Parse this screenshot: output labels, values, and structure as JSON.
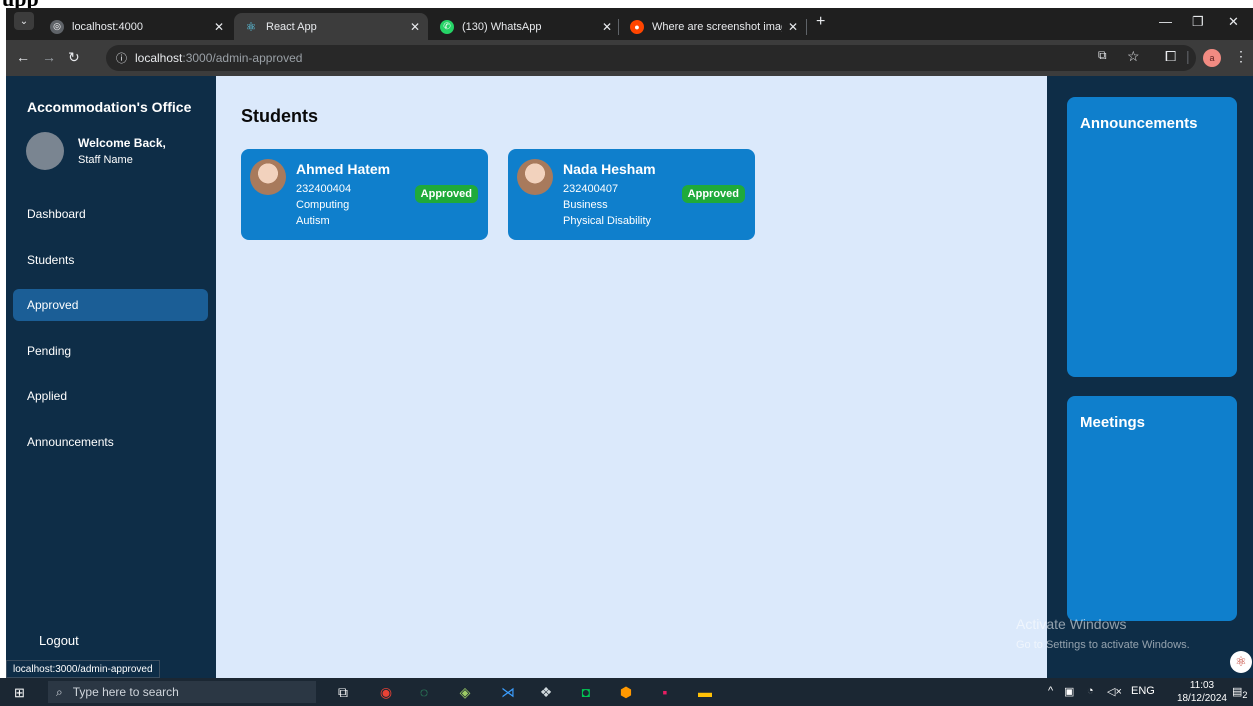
{
  "browser": {
    "tabs": [
      {
        "title": "localhost:4000",
        "active": false
      },
      {
        "title": "React App",
        "active": true
      },
      {
        "title": "(130) WhatsApp",
        "active": false
      },
      {
        "title": "Where are screenshot images s",
        "active": false
      }
    ],
    "new_tab": "+",
    "url_host": "localhost",
    "url_path": ":3000/admin-approved",
    "status_url": "localhost:3000/admin-approved"
  },
  "sidebar": {
    "title": "Accommodation's Office",
    "welcome": "Welcome Back,",
    "staff_name": "Staff Name",
    "items": [
      {
        "label": "Dashboard",
        "active": false
      },
      {
        "label": "Students",
        "active": false
      },
      {
        "label": "Approved",
        "active": true
      },
      {
        "label": "Pending",
        "active": false
      },
      {
        "label": "Applied",
        "active": false
      },
      {
        "label": "Announcements",
        "active": false
      }
    ],
    "logout": "Logout"
  },
  "main": {
    "title": "Students",
    "students": [
      {
        "name": "Ahmed Hatem",
        "id": "232400404",
        "faculty": "Computing",
        "disability": "Autism",
        "status": "Approved"
      },
      {
        "name": "Nada Hesham",
        "id": "232400407",
        "faculty": "Business",
        "disability": "Physical Disability",
        "status": "Approved"
      }
    ]
  },
  "right": {
    "announcements_title": "Announcements",
    "meetings_title": "Meetings"
  },
  "watermark": {
    "line1": "Activate Windows",
    "line2": "Go to Settings to activate Windows."
  },
  "taskbar": {
    "search_placeholder": "Type here to search",
    "lang": "ENG",
    "time": "11:03",
    "date": "18/12/2024",
    "notifications": "2"
  },
  "colors": {
    "sidebar": "#0e2d47",
    "content_bg": "#dbe9fb",
    "card": "#0f7fcc",
    "badge": "#1faa3a",
    "active_nav": "#1b5e96"
  }
}
